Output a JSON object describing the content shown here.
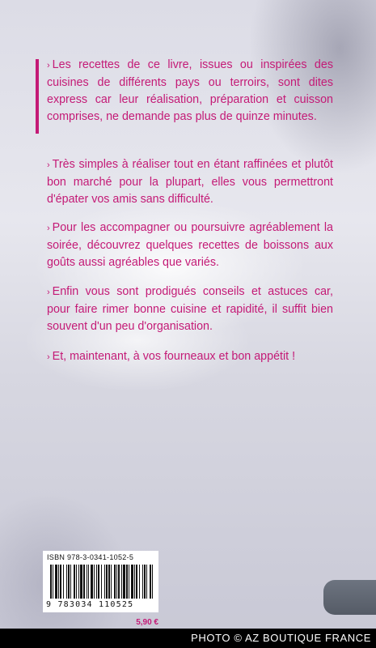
{
  "blurb": {
    "bullet": "›",
    "paragraphs": [
      "Les recettes de ce livre, issues ou inspirées des cuisines de différents pays ou terroirs, sont dites express car leur réalisation, préparation et cuisson comprises, ne demande pas plus de quinze minutes.",
      "Très simples à réaliser tout en étant raffinées et plutôt bon marché pour la plupart, elles vous permettront d'épater vos amis sans difficulté.",
      "Pour les accompagner ou poursuivre agréablement la soirée, découvrez quelques recettes de boissons aux goûts aussi agréables que variés.",
      "Enfin vous sont prodigués conseils et astuces car, pour faire rimer bonne cuisine et rapidité, il suffit bien souvent d'un peu d'organisation.",
      "Et, maintenant, à vos fourneaux et bon appétit !"
    ]
  },
  "barcode": {
    "isbn_label": "ISBN 978-3-0341-1052-5",
    "digits": "9 783034 110525"
  },
  "price": "5,90 €",
  "credit": "PHOTO © AZ BOUTIQUE FRANCE",
  "colors": {
    "accent": "#c41a76",
    "tab": "#5f6570"
  }
}
